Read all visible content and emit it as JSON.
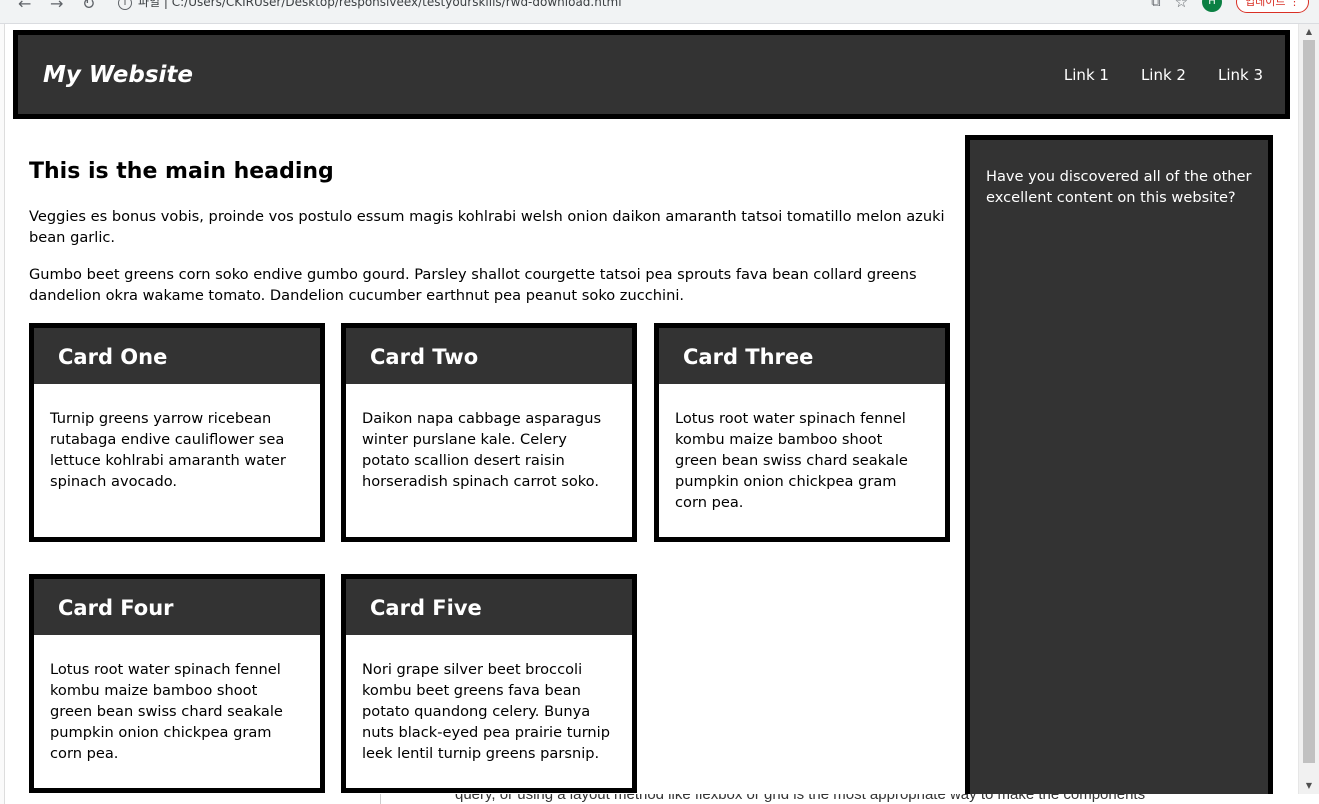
{
  "browser": {
    "url": "파일 | C:/Users/CKIRUser/Desktop/responsiveex/testyourskills/rwd-download.html",
    "profile_initial": "H",
    "update_label": "업데이트"
  },
  "header": {
    "title": "My Website",
    "links": [
      "Link 1",
      "Link 2",
      "Link 3"
    ]
  },
  "main": {
    "heading": "This is the main heading",
    "paragraphs": [
      "Veggies es bonus vobis, proinde vos postulo essum magis kohlrabi welsh onion daikon amaranth tatsoi tomatillo melon azuki bean garlic.",
      "Gumbo beet greens corn soko endive gumbo gourd. Parsley shallot courgette tatsoi pea sprouts fava bean collard greens dandelion okra wakame tomato. Dandelion cucumber earthnut pea peanut soko zucchini."
    ],
    "cards": [
      {
        "title": "Card One",
        "text": "Turnip greens yarrow ricebean rutabaga endive cauliflower sea lettuce kohlrabi amaranth water spinach avocado."
      },
      {
        "title": "Card Two",
        "text": "Daikon napa cabbage asparagus winter purslane kale. Celery potato scallion desert raisin horseradish spinach carrot soko."
      },
      {
        "title": "Card Three",
        "text": "Lotus root water spinach fennel kombu maize bamboo shoot green bean swiss chard seakale pumpkin onion chickpea gram corn pea."
      },
      {
        "title": "Card Four",
        "text": "Lotus root water spinach fennel kombu maize bamboo shoot green bean swiss chard seakale pumpkin onion chickpea gram corn pea."
      },
      {
        "title": "Card Five",
        "text": "Nori grape silver beet broccoli kombu beet greens fava bean potato quandong celery. Bunya nuts black-eyed pea prairie turnip leek lentil turnip greens parsnip."
      }
    ]
  },
  "sidebar": {
    "text": "Have you discovered all of the other excellent content on this website?"
  },
  "underlay": {
    "text": "query, or using a layout method like flexbox or grid is the most appropriate way to make the components"
  },
  "colors": {
    "panel": "#333333",
    "border": "#000000",
    "text_on_dark": "#ffffff"
  }
}
